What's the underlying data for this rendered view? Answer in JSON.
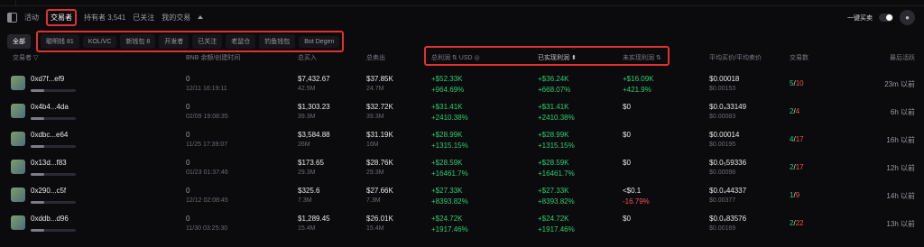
{
  "tabs": {
    "activity": "活动",
    "traders": "交易者",
    "holders_label": "持有者",
    "holders_count": "3,541",
    "following": "已关注",
    "my_trades": "我的交易"
  },
  "controls": {
    "quick_trade": "一键买卖"
  },
  "filters": {
    "all": "全部",
    "items": [
      "聪明钱 81",
      "KOL/VC",
      "新钱包 8",
      "开发者",
      "已关注",
      "老鼠仓",
      "钓鱼钱包",
      "Bot Degen"
    ]
  },
  "columns": {
    "trader": "交易者",
    "bnb_balance": "BNB 余额/创建时间",
    "total_bought": "总买入",
    "total_sold": "总卖出",
    "total_profit": "总利润",
    "usd": "USD",
    "realized": "已实现利润",
    "unrealized": "未实现利润",
    "avg_price": "平均买价/平均卖价",
    "trades": "交易数",
    "last_trade": "最后活跃"
  },
  "rows": [
    {
      "address": "0xd7f...ef9",
      "bnb": "0",
      "created": "12/11 16:19:11",
      "bought": "$7,432.67",
      "bought_amt": "42.5M",
      "sold": "$37.85K",
      "sold_amt": "24.7M",
      "profit": "+$52.33K",
      "profit_pct": "+964.69%",
      "realized": "+$36.24K",
      "realized_pct": "+668.07%",
      "unrealized": "+$16.09K",
      "unrealized_pct": "+421.9%",
      "avg_buy": "$0.00018",
      "avg_sell": "$0.00153",
      "buys": "5",
      "sells": "10",
      "last": "23m 以前"
    },
    {
      "address": "0x4b4...4da",
      "bnb": "0",
      "created": "02/09 19:08:35",
      "bought": "$1,303.23",
      "bought_amt": "39.3M",
      "sold": "$32.72K",
      "sold_amt": "39.3M",
      "profit": "+$31.41K",
      "profit_pct": "+2410.38%",
      "realized": "+$31.41K",
      "realized_pct": "+2410.38%",
      "unrealized": "$0",
      "unrealized_pct": "",
      "avg_buy": "$0.0₄33149",
      "avg_sell": "$0.00083",
      "buys": "2",
      "sells": "4",
      "last": "6h 以前"
    },
    {
      "address": "0xdbc...e64",
      "bnb": "0",
      "created": "11/25 17:39:07",
      "bought": "$3,584.88",
      "bought_amt": "26M",
      "sold": "$31.19K",
      "sold_amt": "16M",
      "profit": "+$28.99K",
      "profit_pct": "+1315.15%",
      "realized": "+$28.99K",
      "realized_pct": "+1315.15%",
      "unrealized": "$0",
      "unrealized_pct": "",
      "avg_buy": "$0.00014",
      "avg_sell": "$0.00195",
      "buys": "4",
      "sells": "17",
      "last": "16h 以前"
    },
    {
      "address": "0x13d...f83",
      "bnb": "0",
      "created": "01/23 01:37:46",
      "bought": "$173.65",
      "bought_amt": "29.3M",
      "sold": "$28.76K",
      "sold_amt": "29.3M",
      "profit": "+$28.59K",
      "profit_pct": "+16461.7%",
      "realized": "+$28.59K",
      "realized_pct": "+16461.7%",
      "unrealized": "$0",
      "unrealized_pct": "",
      "avg_buy": "$0.0₅59336",
      "avg_sell": "$0.00098",
      "buys": "2",
      "sells": "17",
      "last": "12h 以前"
    },
    {
      "address": "0x290...c5f",
      "bnb": "0",
      "created": "12/12 02:08:45",
      "bought": "$325.6",
      "bought_amt": "7.3M",
      "sold": "$27.66K",
      "sold_amt": "7.3M",
      "profit": "+$27.33K",
      "profit_pct": "+8393.82%",
      "realized": "+$27.33K",
      "realized_pct": "+8393.82%",
      "unrealized": "<$0.1",
      "unrealized_pct": "-16.79%",
      "avg_buy": "$0.0₄44337",
      "avg_sell": "$0.00377",
      "buys": "1",
      "sells": "9",
      "last": "14h 以前"
    },
    {
      "address": "0xddb...d96",
      "bnb": "0",
      "created": "11/30 03:25:30",
      "bought": "$1,289.45",
      "bought_amt": "15.4M",
      "sold": "$26.01K",
      "sold_amt": "15.4M",
      "profit": "+$24.72K",
      "profit_pct": "+1917.46%",
      "realized": "+$24.72K",
      "realized_pct": "+1917.46%",
      "unrealized": "$0",
      "unrealized_pct": "",
      "avg_buy": "$0.0₄83576",
      "avg_sell": "$0.00169",
      "buys": "2",
      "sells": "22",
      "last": "13h 以前"
    }
  ]
}
